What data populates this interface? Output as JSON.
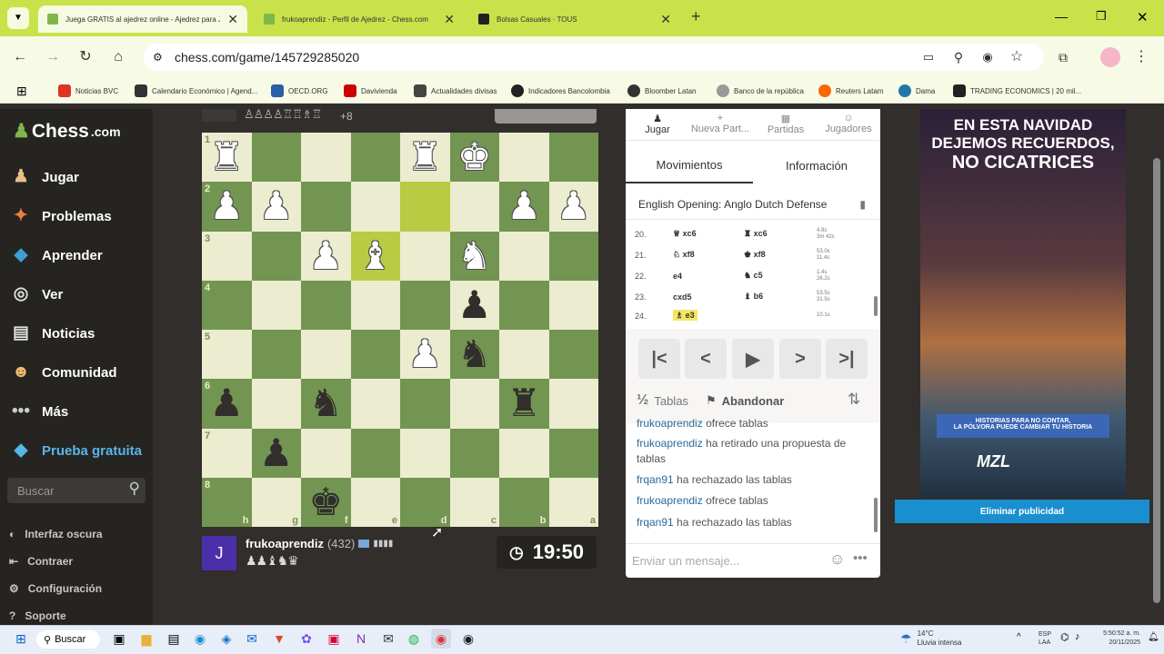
{
  "browser": {
    "tabs": [
      {
        "title": "Juega GRATIS al ajedrez online - Ajedrez para J",
        "active": true
      },
      {
        "title": "frukoaprendiz - Perfil de Ajedrez - Chess.com",
        "active": false
      },
      {
        "title": "Bolsas Casuales · TOUS",
        "active": false
      }
    ],
    "new_tab": "+",
    "url": "chess.com/game/145729285020",
    "bookmarks": [
      "Noticias BVC",
      "Calendario Económico | Agend...",
      "OECD.ORG",
      "Davivienda",
      "Actualidades divisas",
      "Indicadores Bancolombia",
      "Bloomber Latan",
      "Banco de la república",
      "Reuters Latam",
      "Dama",
      "TRADING ECONOMICS | 20 mil..."
    ]
  },
  "sidebar": {
    "logo": "Chess",
    "logo_suffix": ".com",
    "items": [
      {
        "label": "Jugar",
        "icon": "pawn-hand-icon"
      },
      {
        "label": "Problemas",
        "icon": "puzzle-icon"
      },
      {
        "label": "Aprender",
        "icon": "cube-icon"
      },
      {
        "label": "Ver",
        "icon": "binoculars-icon"
      },
      {
        "label": "Noticias",
        "icon": "newspaper-icon"
      },
      {
        "label": "Comunidad",
        "icon": "community-icon"
      },
      {
        "label": "Más",
        "icon": "more-dots-icon"
      }
    ],
    "trial": "Prueba gratuita",
    "search_placeholder": "Buscar",
    "bottom": [
      "Interfaz oscura",
      "Contraer",
      "Configuración",
      "Soporte"
    ]
  },
  "board": {
    "opponent_material": "+8",
    "ranks": [
      "1",
      "2",
      "3",
      "4",
      "5",
      "6",
      "7",
      "8"
    ],
    "files": [
      "h",
      "g",
      "f",
      "e",
      "d",
      "c",
      "b",
      "a"
    ]
  },
  "player": {
    "avatar_letter": "J",
    "name": "frukoaprendiz",
    "rating": "(432)",
    "clock": "19:50"
  },
  "panel": {
    "top_tabs": [
      "Jugar",
      "Nueva Part...",
      "Partidas",
      "Jugadores"
    ],
    "main_tabs": [
      "Movimientos",
      "Información"
    ],
    "opening": "English Opening: Anglo  Dutch Defense",
    "moves": [
      {
        "no": "20.",
        "white": "xc6",
        "black": "xc6",
        "t1": "4.9s",
        "t2": "3m 42s"
      },
      {
        "no": "21.",
        "white": "xf8",
        "black": "xf8",
        "t1": "53.0s",
        "t2": "11.4s"
      },
      {
        "no": "22.",
        "white": "e4",
        "black": "c5",
        "t1": "1.4s",
        "t2": "26.2s"
      },
      {
        "no": "23.",
        "white": "cxd5",
        "black": "b6",
        "t1": "53.5s",
        "t2": "31.5s"
      },
      {
        "no": "24.",
        "white": "e3",
        "black": "",
        "t1": "10.1s",
        "t2": ""
      }
    ],
    "controls": [
      "first-move",
      "previous-move",
      "play",
      "next-move",
      "last-move"
    ],
    "draw_label": "Tablas",
    "draw_symbol": "½",
    "resign_label": "Abandonar",
    "chat": [
      {
        "user": "frukoaprendiz",
        "text": "ofrece tablas"
      },
      {
        "user": "frukoaprendiz",
        "text": "ha retirado una propuesta de tablas"
      },
      {
        "user": "frqan91",
        "text": "ha rechazado las tablas"
      },
      {
        "user": "frukoaprendiz",
        "text": "ofrece tablas"
      },
      {
        "user": "frqan91",
        "text": "ha rechazado las tablas"
      }
    ],
    "chat_placeholder": "Enviar un mensaje..."
  },
  "ad": {
    "line1": "EN ESTA NAVIDAD",
    "line2": "DEJEMOS RECUERDOS,",
    "line3": "NO CICATRICES",
    "banner1": "HISTORIAS PARA NO CONTAR,",
    "banner2": "LA PÓLVORA PUEDE CAMBIAR TU HISTORIA",
    "brand": "MZL",
    "remove": "Eliminar publicidad"
  },
  "taskbar": {
    "search": "Buscar",
    "weather_temp": "14°C",
    "weather_text": "Lluvia intensa",
    "lang1": "ESP",
    "lang2": "LAA",
    "time": "5:50:52 a. m.",
    "date": "20/11/2025"
  }
}
